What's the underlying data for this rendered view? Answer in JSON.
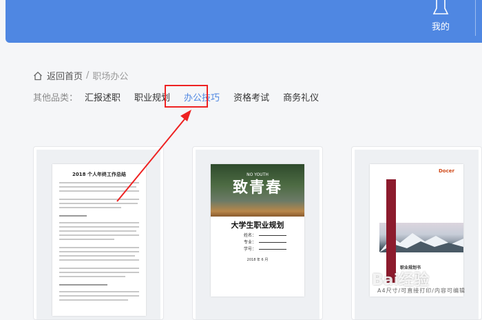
{
  "header": {
    "mine_label": "我的"
  },
  "breadcrumb": {
    "home": "返回首页",
    "separator": "/",
    "current": "职场办公"
  },
  "categories": {
    "label": "其他品类：",
    "items": [
      "汇报述职",
      "职业规划",
      "办公技巧",
      "资格考试",
      "商务礼仪"
    ],
    "active_index": 2
  },
  "annotation": {
    "box_color": "#ee2222"
  },
  "cards": [
    {
      "title": "2018 个人年终工作总结"
    },
    {
      "overline": "NO YOUTH",
      "big_title": "致青春",
      "heading": "大学生职业规划",
      "fields": [
        "姓名：",
        "专业：",
        "学号："
      ],
      "date": "2018 年 6 月"
    },
    {
      "logo": "Docer",
      "title": "职业规划书",
      "caption": "A4尺寸/可直接打印/内容可编辑"
    }
  ],
  "watermark": "Bai经验",
  "colors": {
    "brand": "#4f87e2",
    "accent": "#4f87e2",
    "annotation": "#ee2222"
  }
}
